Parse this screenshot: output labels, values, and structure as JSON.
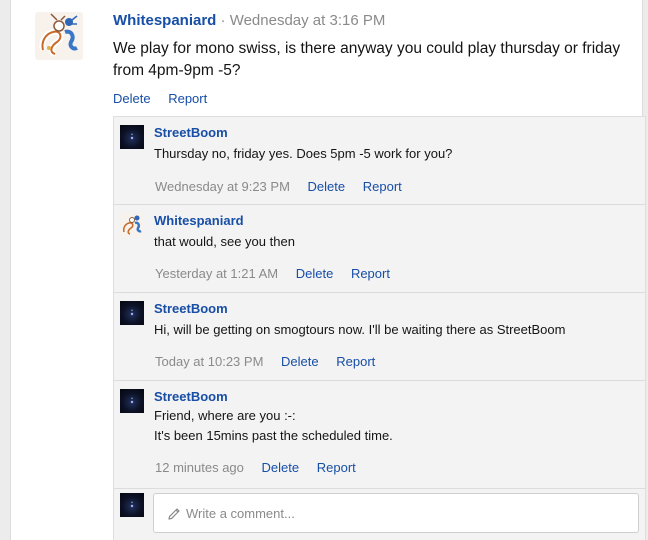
{
  "post": {
    "author": "Whitespaniard",
    "separator": "·",
    "time": "Wednesday at 3:16 PM",
    "body": "We play for mono swiss, is there anyway you could play thursday or friday from 4pm-9pm -5?",
    "actions": {
      "delete": "Delete",
      "report": "Report"
    },
    "avatar_icon": "dragonair-mascot-icon"
  },
  "comments": [
    {
      "author": "StreetBoom",
      "lines": [
        "Thursday no, friday yes. Does 5pm -5 work for you?"
      ],
      "time": "Wednesday at 9:23 PM",
      "delete": "Delete",
      "report": "Report",
      "avatar_icon": "night-sky-avatar-icon"
    },
    {
      "author": "Whitespaniard",
      "lines": [
        "that would, see you then"
      ],
      "time": "Yesterday at 1:21 AM",
      "delete": "Delete",
      "report": "Report",
      "avatar_icon": "dragonair-mascot-icon"
    },
    {
      "author": "StreetBoom",
      "lines": [
        "Hi, will be getting on smogtours now. I'll be waiting there as StreetBoom"
      ],
      "time": "Today at 10:23 PM",
      "delete": "Delete",
      "report": "Report",
      "avatar_icon": "night-sky-avatar-icon"
    },
    {
      "author": "StreetBoom",
      "lines": [
        "Friend, where are you :-:",
        "It's been 15mins past the scheduled time."
      ],
      "time": "12 minutes ago",
      "delete": "Delete",
      "report": "Report",
      "avatar_icon": "night-sky-avatar-icon"
    }
  ],
  "compose": {
    "placeholder": "Write a comment...",
    "icon": "pencil-icon",
    "avatar_icon": "night-sky-avatar-icon"
  },
  "colors": {
    "link": "#174ea6",
    "meta": "#8a8a8a",
    "page_bg": "#ececec",
    "comments_bg": "#f3f3f3"
  }
}
